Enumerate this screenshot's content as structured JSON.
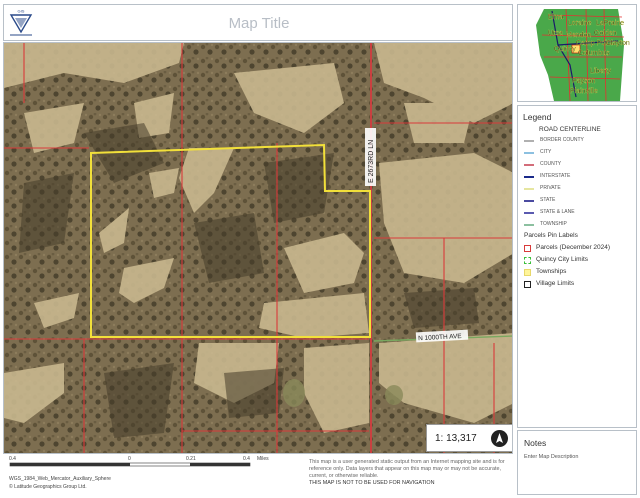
{
  "header": {
    "logo_text": "GIS",
    "title": "Map Title"
  },
  "map": {
    "road_label_vertical": "E 2673RD LN",
    "road_label_horizontal": "N 1000TH AVE",
    "scale_text": "1: 13,317",
    "colors": {
      "parcel": "#d93a3a",
      "township": "#f2e03a",
      "aerial": "#8a7a5a"
    }
  },
  "scalebar": {
    "ticks": [
      "0.4",
      "0",
      "0.21",
      "0.4"
    ],
    "unit": "Miles"
  },
  "footer": {
    "projection": "WGS_1984_Web_Mercator_Auxiliary_Sphere",
    "copyright": "© Latitude Geographics Group Ltd.",
    "disclaimer": "This map is a user generated static output from an Internet mapping site and is for reference only. Data layers that appear on this map may or may not be accurate, current, or otherwise reliable.",
    "navigation": "THIS MAP IS NOT TO BE USED FOR NAVIGATION"
  },
  "overview": {
    "labels": [
      "Lima",
      "Loraine",
      "LaPrairie",
      "Ursa",
      "Mendon",
      "Golden",
      "Camp Point",
      "Clayton",
      "Quincy",
      "Columbus",
      "Liberty",
      "Payson",
      "Plainville"
    ]
  },
  "legend": {
    "title": "Legend",
    "road_header": "ROAD CENTERLINE",
    "road_items": [
      {
        "label": "BORDER COUNTY",
        "color": "#b0b0b0"
      },
      {
        "label": "CITY",
        "color": "#8cc0e0"
      },
      {
        "label": "COUNTY",
        "color": "#d36d7a"
      },
      {
        "label": "INTERSTATE",
        "color": "#1a2a8a"
      },
      {
        "label": "PRIVATE",
        "color": "#e6e6a0"
      },
      {
        "label": "STATE",
        "color": "#4a4aa0"
      },
      {
        "label": "STATE & LANE",
        "color": "#5a5ab0"
      },
      {
        "label": "TOWNSHIP",
        "color": "#8cc0a0"
      }
    ],
    "other_items": [
      {
        "label": "Parcels Pin Labels",
        "style": "none",
        "color": ""
      },
      {
        "label": "Parcels (December 2024)",
        "style": "outline",
        "color": "#d93a3a"
      },
      {
        "label": "Quincy City Limits",
        "style": "dashed",
        "color": "#3ac03a"
      },
      {
        "label": "Townships",
        "style": "fill",
        "color": "#fff59a"
      },
      {
        "label": "Village Limits",
        "style": "outline",
        "color": "#222222"
      }
    ]
  },
  "notes": {
    "title": "Notes",
    "description": "Enter Map Description"
  }
}
